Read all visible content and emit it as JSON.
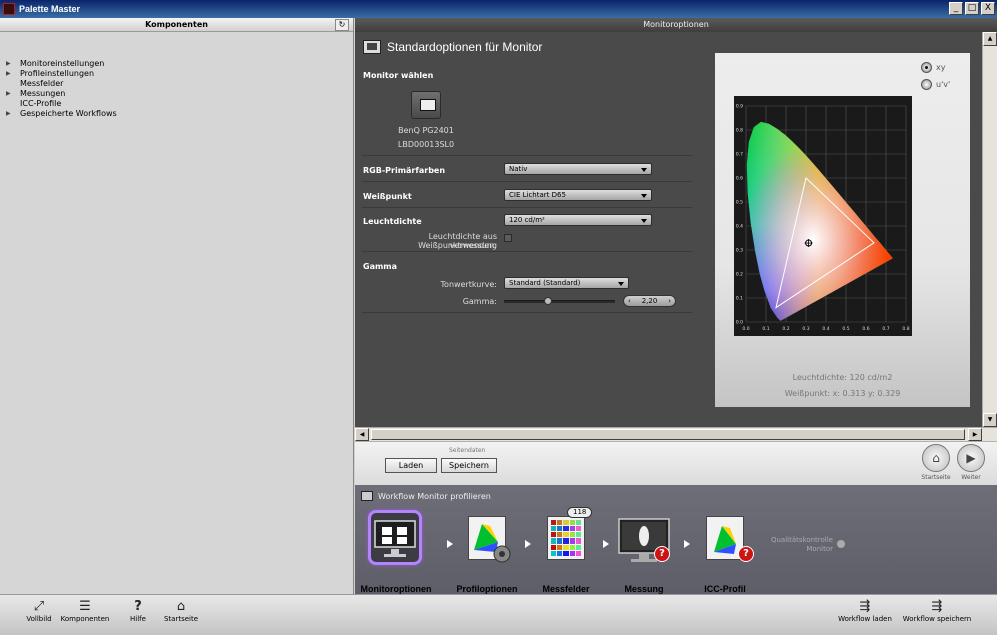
{
  "window": {
    "title": "Palette Master",
    "controls": [
      "_",
      "□",
      "X"
    ]
  },
  "left_panel": {
    "header": "Komponenten",
    "items": [
      {
        "label": "Monitoreinstellungen",
        "expandable": true
      },
      {
        "label": "Profileinstellungen",
        "expandable": true
      },
      {
        "label": "Messfelder",
        "expandable": false
      },
      {
        "label": "Messungen",
        "expandable": true
      },
      {
        "label": "ICC-Profile",
        "expandable": false
      },
      {
        "label": "Gespeicherte Workflows",
        "expandable": true
      }
    ]
  },
  "main": {
    "header": "Monitoroptionen",
    "section_title": "Standardoptionen für Monitor",
    "monitor_select_label": "Monitor wählen",
    "monitor_name": "BenQ PG2401",
    "monitor_serial": "LBD00013SL0",
    "rgb_label": "RGB-Primärfarben",
    "rgb_value": "Nativ",
    "whitepoint_label": "Weißpunkt",
    "whitepoint_value": "CIE Lichtart D65",
    "luminance_label": "Leuchtdichte",
    "luminance_value": "120 cd/m²",
    "luminance_check_label_1": "Leuchtdichte aus Weißpunktmessung",
    "luminance_check_label_2": "verwenden:",
    "gamma_label": "Gamma",
    "tone_curve_label": "Tonwertkurve:",
    "tone_curve_value": "Standard (Standard)",
    "gamma_field_label": "Gamma:",
    "gamma_value": "2,20",
    "gamma_slider_fraction": 0.4
  },
  "chart": {
    "radio_xy": "xy",
    "radio_uv": "u'v'",
    "selected": "xy",
    "luminance_text": "Leuchtdichte: 120 cd/m2",
    "whitepoint_text": "Weißpunkt: x: 0.313  y: 0.329"
  },
  "chart_data": {
    "type": "scatter",
    "title": "",
    "xlabel": "",
    "ylabel": "",
    "xlim": [
      0,
      0.8
    ],
    "ylim": [
      0,
      0.9
    ],
    "x_ticks": [
      "0.0",
      "0.1",
      "0.2",
      "0.3",
      "0.4",
      "0.5",
      "0.6",
      "0.7",
      "0.8"
    ],
    "y_ticks": [
      "0.0",
      "0.1",
      "0.2",
      "0.3",
      "0.4",
      "0.5",
      "0.6",
      "0.7",
      "0.8",
      "0.9"
    ],
    "gamut_triangle": [
      {
        "x": 0.64,
        "y": 0.33
      },
      {
        "x": 0.3,
        "y": 0.6
      },
      {
        "x": 0.15,
        "y": 0.06
      }
    ],
    "white_point": {
      "x": 0.313,
      "y": 0.329
    },
    "grid": true
  },
  "page_bar": {
    "caption": "Seitendaten",
    "load_label": "Laden",
    "save_label": "Speichern",
    "home_label": "Startseite",
    "next_label": "Weiter"
  },
  "workflow": {
    "title": "Workflow Monitor profilieren",
    "steps": [
      {
        "label": "Monitoroptionen"
      },
      {
        "label": "Profiloptionen"
      },
      {
        "label": "Messfelder",
        "badge": "118"
      },
      {
        "label": "Messung"
      },
      {
        "label": "ICC-Profil"
      }
    ],
    "quality_line1": "Qualitätskontrolle",
    "quality_line2": "Monitor"
  },
  "toolbar": {
    "fullscreen": "Vollbild",
    "components": "Komponenten",
    "help": "Hilfe",
    "home": "Startseite",
    "load_workflow": "Workflow laden",
    "save_workflow": "Workflow speichern"
  },
  "colors": {
    "accent_purple": "#b484ff",
    "error_red": "#cc1414",
    "panel_dark": "#4a4a4a"
  }
}
